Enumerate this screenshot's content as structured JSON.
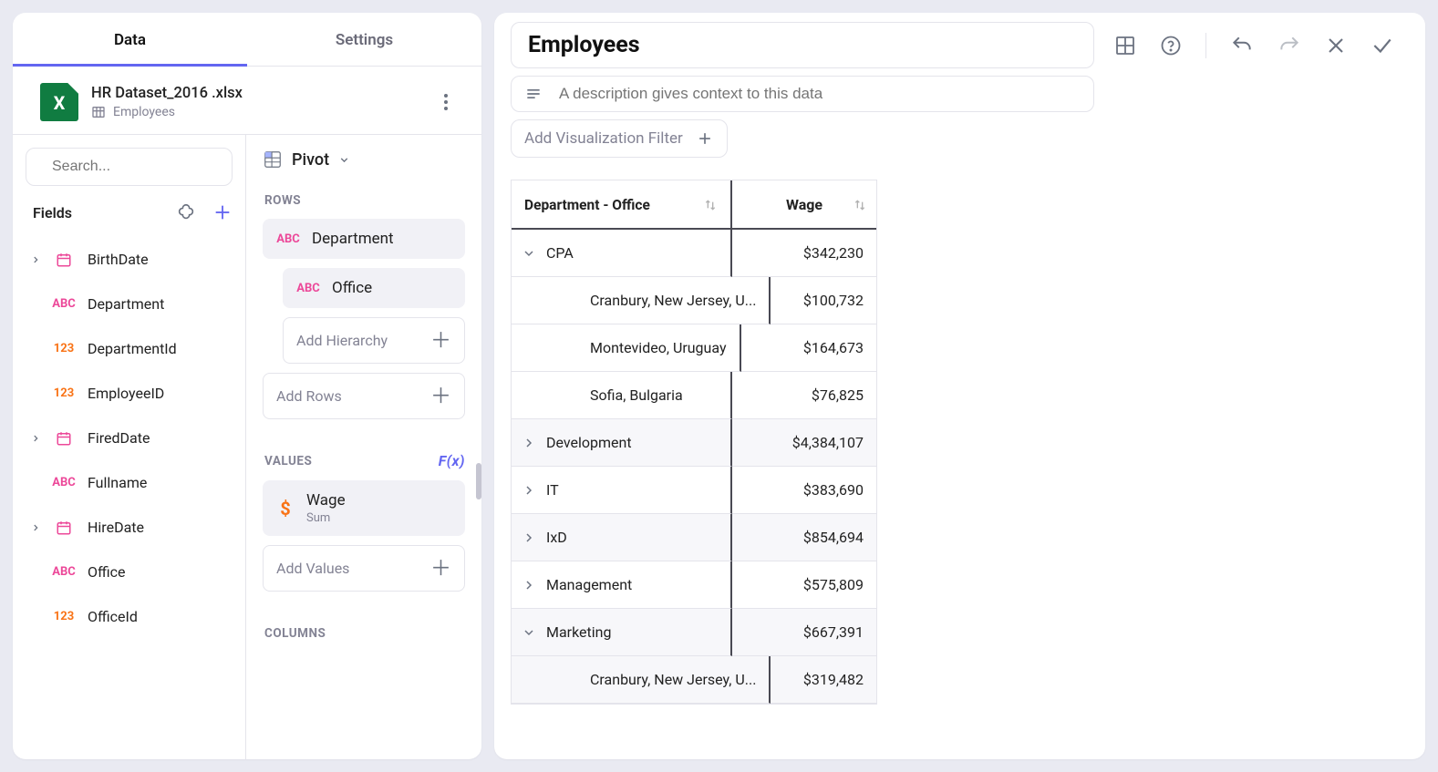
{
  "tabs": {
    "data": "Data",
    "settings": "Settings"
  },
  "dataset": {
    "filename": "HR Dataset_2016 .xlsx",
    "table": "Employees"
  },
  "search": {
    "placeholder": "Search..."
  },
  "fieldsHeader": "Fields",
  "fields": [
    {
      "name": "BirthDate",
      "type": "date",
      "expandable": true
    },
    {
      "name": "Department",
      "type": "text",
      "expandable": false
    },
    {
      "name": "DepartmentId",
      "type": "number",
      "expandable": false
    },
    {
      "name": "EmployeeID",
      "type": "number",
      "expandable": false
    },
    {
      "name": "FiredDate",
      "type": "date",
      "expandable": true
    },
    {
      "name": "Fullname",
      "type": "text",
      "expandable": false
    },
    {
      "name": "HireDate",
      "type": "date",
      "expandable": true
    },
    {
      "name": "Office",
      "type": "text",
      "expandable": false
    },
    {
      "name": "OfficeId",
      "type": "number",
      "expandable": false
    }
  ],
  "config": {
    "visType": "Pivot",
    "sections": {
      "rows": "ROWS",
      "values": "VALUES",
      "columns": "COLUMNS"
    },
    "rowPills": {
      "department": "Department",
      "office": "Office"
    },
    "addHierarchy": "Add Hierarchy",
    "addRows": "Add Rows",
    "valuePills": {
      "wage": {
        "label": "Wage",
        "agg": "Sum"
      }
    },
    "addValues": "Add Values",
    "fx": "F(x)"
  },
  "viz": {
    "title": "Employees",
    "descPlaceholder": "A description gives context to this data",
    "addFilter": "Add Visualization Filter",
    "columns": {
      "dim": "Department - Office",
      "val": "Wage"
    },
    "rows": [
      {
        "label": "CPA",
        "value": "$342,230",
        "level": 1,
        "state": "open",
        "alt": false
      },
      {
        "label": "Cranbury, New Jersey, U...",
        "value": "$100,732",
        "level": 2,
        "state": "leaf",
        "alt": false
      },
      {
        "label": "Montevideo, Uruguay",
        "value": "$164,673",
        "level": 2,
        "state": "leaf",
        "alt": false
      },
      {
        "label": "Sofia, Bulgaria",
        "value": "$76,825",
        "level": 2,
        "state": "leaf",
        "alt": false
      },
      {
        "label": "Development",
        "value": "$4,384,107",
        "level": 1,
        "state": "closed",
        "alt": true
      },
      {
        "label": "IT",
        "value": "$383,690",
        "level": 1,
        "state": "closed",
        "alt": false
      },
      {
        "label": "IxD",
        "value": "$854,694",
        "level": 1,
        "state": "closed",
        "alt": true
      },
      {
        "label": "Management",
        "value": "$575,809",
        "level": 1,
        "state": "closed",
        "alt": false
      },
      {
        "label": "Marketing",
        "value": "$667,391",
        "level": 1,
        "state": "open",
        "alt": true
      },
      {
        "label": "Cranbury, New Jersey, U...",
        "value": "$319,482",
        "level": 2,
        "state": "leaf",
        "alt": true
      }
    ]
  }
}
